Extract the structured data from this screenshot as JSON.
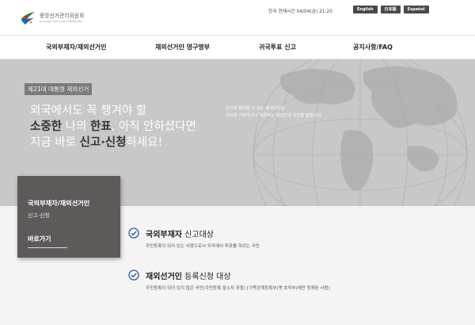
{
  "header": {
    "org_name": "중앙선거관리위원회",
    "org_sub": "NATIONAL ELECTION COMMISSION",
    "current_time": "한국 현재시간 04/04(금) 21:20",
    "languages": [
      "English",
      "日本語",
      "Español"
    ]
  },
  "nav": {
    "items": [
      "국외부재자/재외선거인",
      "재외선거인 영구명부",
      "귀국투표 신고",
      "공지사항/FAQ"
    ]
  },
  "hero": {
    "event_tag": "제21대 대통령 재외선거",
    "line1": "외국에서도 꼭 챙겨야 할",
    "line2_a": "소중한",
    "line2_b": " 나의 ",
    "line2_c": "한표",
    "line2_d": ", 아직 안하셨다면",
    "line3_a": "지금 바로 ",
    "line3_b": "신고·신청",
    "line3_c": "하세요!",
    "desc_line1": "선거에 참여할 수 있는 재외국민은",
    "desc_line2": "국외에 거주하거나 체류하는 대한민국 국민을 말합니다."
  },
  "card": {
    "title": "국외부재자/재외선거인",
    "subtitle": "신고·신청",
    "link": "바로가기"
  },
  "info": {
    "item1_title_a": "국외부재자",
    "item1_title_b": " 신고대상",
    "item1_desc": "주민등록이 되어 있는 사람으로서 외국에서 투표를 하려는 국민",
    "item2_title_a": "재외선거인",
    "item2_title_b": " 등록신청 대상",
    "item2_desc": "주민등록이 되어 있지 않은 국민(주민등록 말소자 포함) [가족관계등록부(옛 호적부)에만 등재된 사람]"
  },
  "colors": {
    "hero_bg": "#c8c8c8",
    "card_bg": "#5f5a5a",
    "check_blue": "#2d5f9a",
    "lang_btn": "#4a4a4a"
  }
}
